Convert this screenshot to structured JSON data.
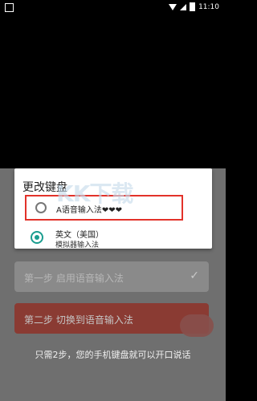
{
  "status_bar": {
    "time": "11:10"
  },
  "dialog": {
    "title": "更改键盘",
    "options": [
      {
        "label": "A语音输入法❤❤❤",
        "selected": false
      },
      {
        "label": "英文（美国）",
        "sublabel": "模拟器输入法",
        "selected": true
      }
    ]
  },
  "steps": {
    "step1": "第一步  启用语音输入法",
    "step2": "第二步  切换到语音输入法"
  },
  "hint": "只需2步，您的手机键盘就可以开口说话",
  "watermark": "KK下载"
}
